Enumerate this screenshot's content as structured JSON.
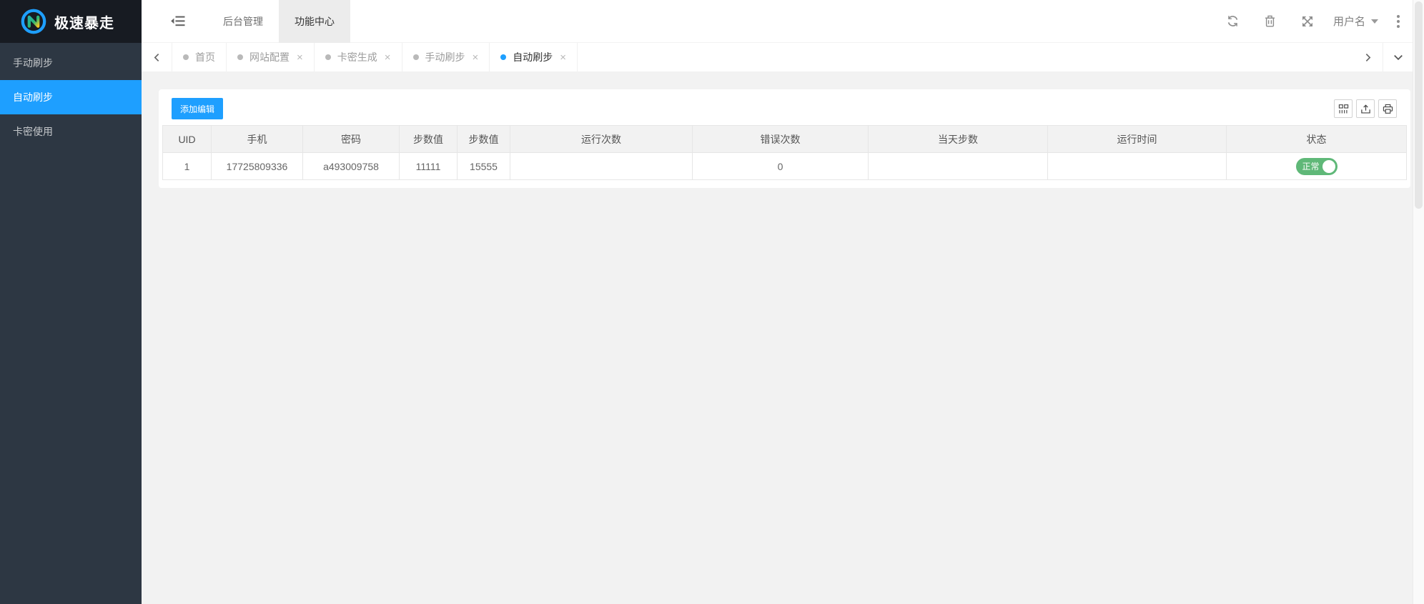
{
  "app": {
    "title": "极速暴走"
  },
  "sidebar": {
    "items": [
      {
        "label": "手动刷步",
        "active": false
      },
      {
        "label": "自动刷步",
        "active": true
      },
      {
        "label": "卡密使用",
        "active": false
      }
    ]
  },
  "header": {
    "nav": [
      {
        "label": "后台管理",
        "active": false
      },
      {
        "label": "功能中心",
        "active": true
      }
    ],
    "username": "用户名"
  },
  "tabs": {
    "items": [
      {
        "label": "首页",
        "closable": false,
        "active": false
      },
      {
        "label": "网站配置",
        "closable": true,
        "active": false
      },
      {
        "label": "卡密生成",
        "closable": true,
        "active": false
      },
      {
        "label": "手动刷步",
        "closable": true,
        "active": false
      },
      {
        "label": "自动刷步",
        "closable": true,
        "active": true
      }
    ]
  },
  "toolbar": {
    "add_button": "添加编辑"
  },
  "table": {
    "headers": [
      "UID",
      "手机",
      "密码",
      "步数值",
      "步数值",
      "运行次数",
      "错误次数",
      "当天步数",
      "运行时间",
      "状态"
    ],
    "row": {
      "uid": "1",
      "phone": "17725809336",
      "password": "a493009758",
      "step_min": "11111",
      "step_max": "15555",
      "run_count": "",
      "error_count": "0",
      "today_steps": "",
      "run_time": "",
      "status_label": "正常"
    }
  },
  "icons": {
    "close_glyph": "×"
  },
  "colors": {
    "accent": "#1E9FFF",
    "switch_on": "#5FB878",
    "sidebar_bg": "#2d3743",
    "logo_bg": "#171b22",
    "content_bg": "#f2f2f2"
  }
}
